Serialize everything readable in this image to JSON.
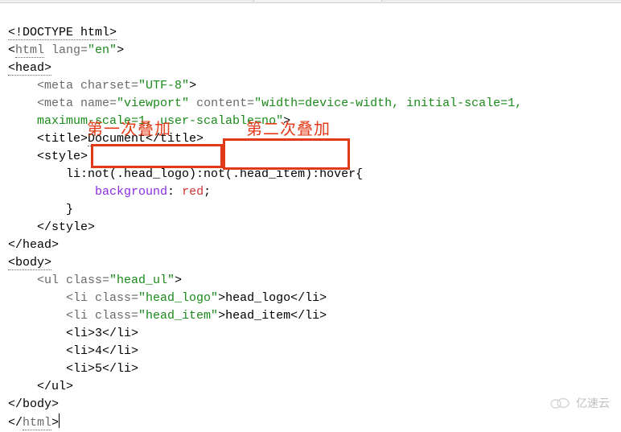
{
  "code": {
    "doctype": "<!DOCTYPE html>",
    "html_open_1": "<",
    "html_open_tag": "html",
    "html_open_2": " lang=",
    "html_lang": "\"en\"",
    "html_open_3": ">",
    "head_open": "<head>",
    "meta1_a": "<meta charset=",
    "meta1_val": "\"UTF-8\"",
    "meta1_b": ">",
    "meta2_a": "<meta name=",
    "meta2_name": "\"viewport\"",
    "meta2_b": " content=",
    "meta2_content1": "\"width=device-width, initial-scale=1,",
    "meta2_content2": "maximum-scale=1, user-scalable=no\"",
    "meta2_c": ">",
    "title_a": "<title>",
    "title_txt": "Document",
    "title_b": "</title>",
    "style_open": "<style>",
    "css_selector": "li:not(.head_logo):not(.head_item):hover{",
    "css_prop": "background",
    "css_colon": ": ",
    "css_val": "red",
    "css_semi": ";",
    "css_close": "}",
    "style_close": "</style>",
    "head_close": "</head>",
    "body_open": "<body>",
    "ul_a": "<ul class=",
    "ul_cls": "\"head_ul\"",
    "ul_b": ">",
    "li1_a": "<li class=",
    "li1_cls": "\"head_logo\"",
    "li1_b": ">head_logo</li>",
    "li2_a": "<li class=",
    "li2_cls": "\"head_item\"",
    "li2_b": ">head_item</li>",
    "li3": "<li>3</li>",
    "li4": "<li>4</li>",
    "li5": "<li>5</li>",
    "ul_close": "</ul>",
    "body_close": "</body>",
    "html_close_1": "</",
    "html_close_tag": "html",
    "html_close_2": ">"
  },
  "annotation": {
    "first": "第一次叠加",
    "second": "第二次叠加"
  },
  "watermark": "亿速云"
}
